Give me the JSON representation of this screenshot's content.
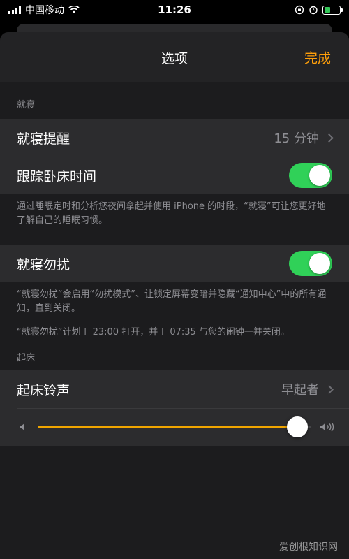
{
  "status_bar": {
    "carrier": "中国移动",
    "time": "11:26"
  },
  "nav": {
    "title": "选项",
    "done_label": "完成"
  },
  "bedtime_section": {
    "header": "就寝",
    "reminder_label": "就寝提醒",
    "reminder_value": "15 分钟",
    "track_label": "跟踪卧床时间",
    "track_on": true,
    "track_footer": "通过睡眠定时和分析您夜间拿起并使用 iPhone 的时段，“就寝”可让您更好地了解自己的睡眠习惯。"
  },
  "dnd_section": {
    "label": "就寝勿扰",
    "on": true,
    "footer_1": "“就寝勿扰”会启用“勿扰模式”、让锁定屏幕变暗并隐藏“通知中心”中的所有通知，直到关闭。",
    "footer_2": "“就寝勿扰”计划于 23:00 打开，并于 07:35 与您的闹钟一并关闭。"
  },
  "wake_section": {
    "header": "起床",
    "sound_label": "起床铃声",
    "sound_value": "早起者",
    "volume_fraction": 0.95
  },
  "icons": {
    "wifi": "wifi-icon",
    "battery": "battery-icon",
    "chevron": "chevron-right-icon",
    "speaker_low": "speaker-low-icon",
    "speaker_high": "speaker-high-icon"
  },
  "colors": {
    "accent": "#ff9f0a",
    "toggle_on": "#30d158",
    "slider_fill": "#f0a500"
  },
  "watermark": "爱创根知识网"
}
